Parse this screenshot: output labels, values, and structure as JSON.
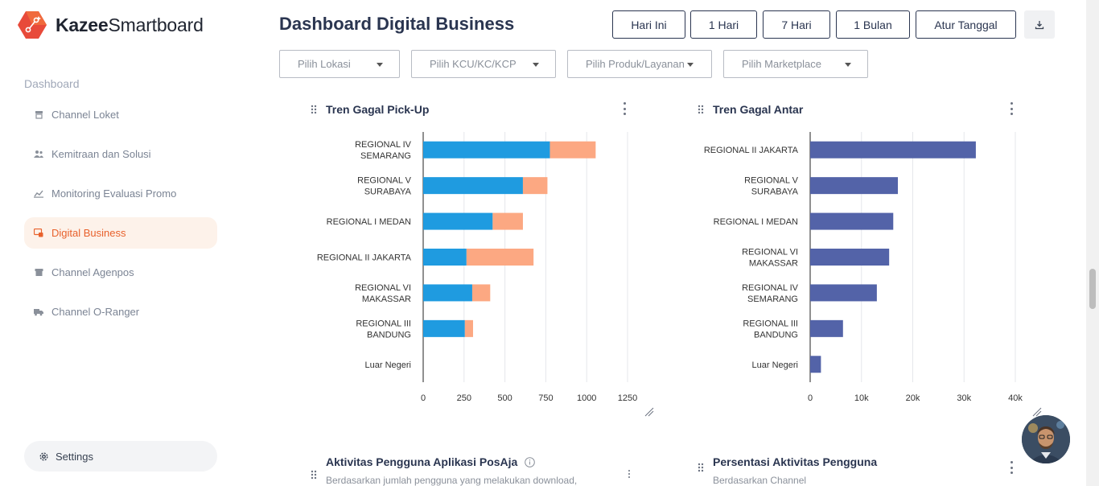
{
  "brand": {
    "name_bold": "Kazee",
    "name_rest": "Smartboard"
  },
  "sidebar": {
    "section": "Dashboard",
    "items": [
      {
        "label": "Channel Loket",
        "icon": "counter-icon",
        "active": false
      },
      {
        "label": "Kemitraan dan Solusi",
        "icon": "people-icon",
        "active": false
      },
      {
        "label": "Monitoring Evaluasi Promo",
        "icon": "promo-chart-icon",
        "active": false
      },
      {
        "label": "Digital Business",
        "icon": "digital-business-icon",
        "active": true
      },
      {
        "label": "Channel Agenpos",
        "icon": "store-icon",
        "active": false
      },
      {
        "label": "Channel O-Ranger",
        "icon": "truck-icon",
        "active": false
      }
    ],
    "settings": "Settings"
  },
  "header": {
    "title": "Dashboard Digital Business",
    "ranges": [
      "Hari Ini",
      "1 Hari",
      "7 Hari",
      "1 Bulan",
      "Atur Tanggal"
    ]
  },
  "filters": [
    "Pilih Lokasi",
    "Pilih KCU/KC/KCP",
    "Pilih Produk/Layanan",
    "Pilih Marketplace"
  ],
  "cards": {
    "pickup": {
      "title": "Tren Gagal Pick-Up"
    },
    "antar": {
      "title": "Tren Gagal Antar"
    },
    "aktivitas": {
      "title": "Aktivitas Pengguna Aplikasi PosAja",
      "subtitle": "Berdasarkan jumlah pengguna yang melakukan download,"
    },
    "persentasi": {
      "title": "Persentasi Aktivitas Pengguna",
      "subtitle": "Berdasarkan Channel"
    }
  },
  "colors": {
    "accent": "#e8612c",
    "primary_navy": "#2a3550",
    "pickup_a": "#1f9be0",
    "pickup_b": "#fca882",
    "antar": "#5363a8"
  },
  "chart_data": [
    {
      "type": "bar",
      "orientation": "horizontal",
      "stacked": true,
      "title": "Tren Gagal Pick-Up",
      "categories": [
        [
          "REGIONAL IV",
          "SEMARANG"
        ],
        [
          "REGIONAL V",
          "SURABAYA"
        ],
        [
          "REGIONAL I MEDAN"
        ],
        [
          "REGIONAL II JAKARTA"
        ],
        [
          "REGIONAL VI",
          "MAKASSAR"
        ],
        [
          "REGIONAL III",
          "BANDUNG"
        ],
        [
          "Luar Negeri"
        ]
      ],
      "series": [
        {
          "values": [
            775,
            610,
            425,
            265,
            300,
            255,
            0
          ]
        },
        {
          "values": [
            280,
            150,
            185,
            410,
            110,
            50,
            0
          ]
        }
      ],
      "xticks": [
        "0",
        "250",
        "500",
        "750",
        "1000",
        "1250"
      ],
      "xlim": [
        0,
        1250
      ],
      "grid": true
    },
    {
      "type": "bar",
      "orientation": "horizontal",
      "title": "Tren Gagal Antar",
      "categories": [
        [
          "REGIONAL II JAKARTA"
        ],
        [
          "REGIONAL V",
          "SURABAYA"
        ],
        [
          "REGIONAL I MEDAN"
        ],
        [
          "REGIONAL VI",
          "MAKASSAR"
        ],
        [
          "REGIONAL IV",
          "SEMARANG"
        ],
        [
          "REGIONAL III",
          "BANDUNG"
        ],
        [
          "Luar Negeri"
        ]
      ],
      "values": [
        32300,
        17100,
        16200,
        15400,
        13000,
        6400,
        2100
      ],
      "xticks": [
        "0",
        "10k",
        "20k",
        "30k",
        "40k"
      ],
      "xlim": [
        0,
        40000
      ],
      "grid": true
    }
  ]
}
